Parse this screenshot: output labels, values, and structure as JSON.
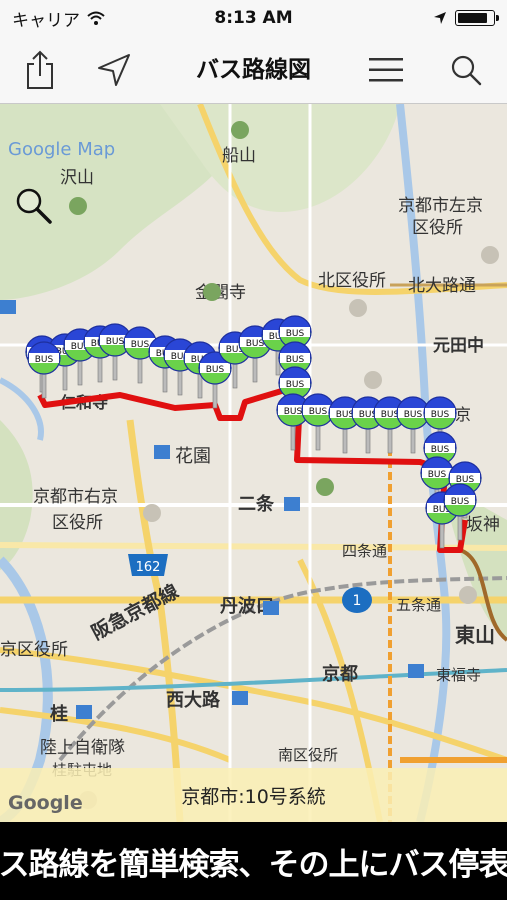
{
  "status_bar": {
    "carrier": "キャリア",
    "time": "8:13 AM",
    "icons": [
      "wifi-icon",
      "location-arrow-icon",
      "battery-icon"
    ],
    "battery_level": 0.9
  },
  "nav_bar": {
    "title": "バス路線図",
    "buttons": [
      "share-icon",
      "location-icon",
      "menu-icon",
      "search-icon"
    ]
  },
  "map": {
    "google_map_label": "Google Map",
    "google_logo": "Google",
    "route_line_color": "#e01010",
    "labels": {
      "sawayama": "沢山",
      "funayama": "船山",
      "kinkakuji": "金閣寺",
      "kita_ward_office": "北区役所",
      "kyoto_sakyo": "京都市左京",
      "ward_office": "区役所",
      "kitaoji_dori": "北大路通",
      "kitaoji_short": "北大路",
      "motoyanaka": "元田中",
      "hanazono": "花園",
      "kyoto_ukyo": "京都市右京",
      "ukyo_ward_office": "区役所",
      "nijo": "二条",
      "shijo_dori": "四条通",
      "tambaguchi": "丹波口",
      "gojo_dori": "五条通",
      "higashiyama": "東山",
      "hankyu_line": "阪急京都線",
      "nishikyo_ward_office": "京区役所",
      "kyoto": "京都",
      "tofukuji": "東福寺",
      "katsura": "桂",
      "nishioji": "西大路",
      "jsdf": "陸上自衛隊",
      "katsura_camp": "桂駐屯地",
      "minami_ward_office": "南区役所",
      "route_162": "162",
      "route_1": "1",
      "ninnaji": "仁和寺",
      "kita_pref": "京",
      "kiyo": "坂神",
      "bus_tag": "BUS"
    }
  },
  "route_name": "京都市:10号系統",
  "caption": "バス路線を簡単検索、その上にバス停表示"
}
